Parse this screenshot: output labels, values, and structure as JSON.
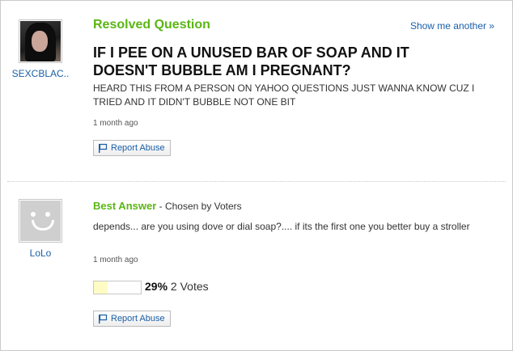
{
  "question": {
    "section_title": "Resolved Question",
    "show_another_label": "Show me another »",
    "asker_name": "SEXCBLAC..",
    "title": "IF I PEE ON A UNUSED BAR OF SOAP AND IT DOESN'T BUBBLE AM I PREGNANT?",
    "body": "HEARD THIS FROM A PERSON ON YAHOO QUESTIONS JUST WANNA KNOW CUZ I TRIED AND IT DIDN'T BUBBLE NOT ONE BIT",
    "timestamp": "1 month ago",
    "report_label": "Report Abuse"
  },
  "answer": {
    "section_title": "Best Answer",
    "chosen_by": " - Chosen by Voters",
    "answerer_name": "LoLo",
    "body": "depends... are you using dove or dial soap?.... if its the first one you better buy a stroller",
    "timestamp": "1 month ago",
    "vote_percent_label": "29%",
    "vote_count_label": "2 Votes",
    "vote_fraction": 0.29,
    "report_label": "Report Abuse"
  },
  "colors": {
    "accent_green": "#5bb614",
    "link_blue": "#1a5fa8",
    "vote_fill": "#fffbc4"
  },
  "icons": {
    "report": "flag-icon",
    "default_avatar": "smiley-avatar"
  }
}
